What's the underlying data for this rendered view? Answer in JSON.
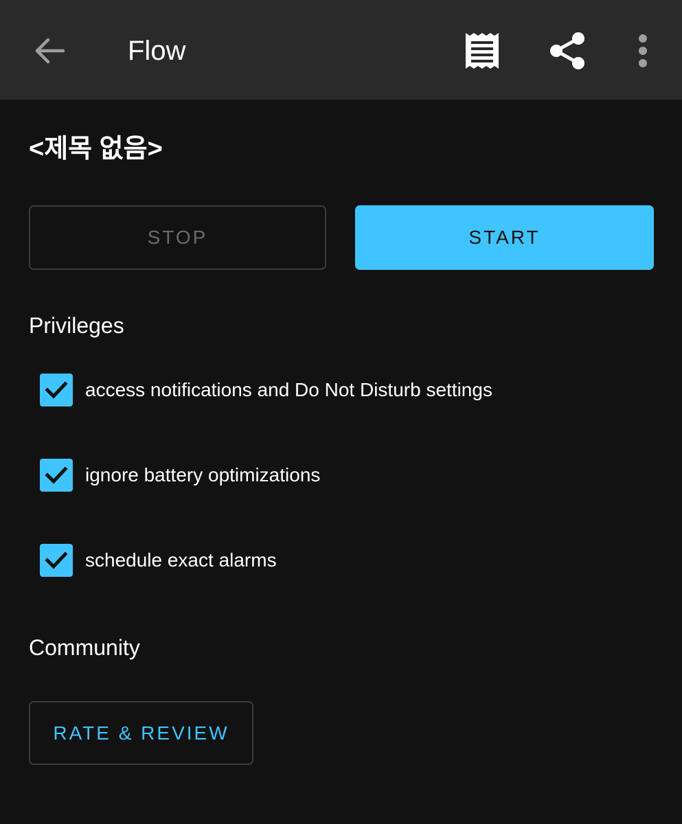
{
  "appbar": {
    "title": "Flow",
    "icons": {
      "back": "arrow-back-icon",
      "log": "receipt-icon",
      "share": "share-icon",
      "more": "more-vert-icon"
    }
  },
  "flow": {
    "title": "<제목 없음>"
  },
  "controls": {
    "stop_label": "STOP",
    "start_label": "START"
  },
  "privileges": {
    "heading": "Privileges",
    "items": [
      {
        "label": "access notifications and Do Not Disturb settings",
        "checked": true
      },
      {
        "label": "ignore battery optimizations",
        "checked": true
      },
      {
        "label": "schedule exact alarms",
        "checked": true
      }
    ]
  },
  "community": {
    "heading": "Community",
    "rate_label": "RATE & REVIEW"
  },
  "colors": {
    "accent": "#40c4ff",
    "background": "#121212",
    "appbar": "#2a2a2a"
  }
}
